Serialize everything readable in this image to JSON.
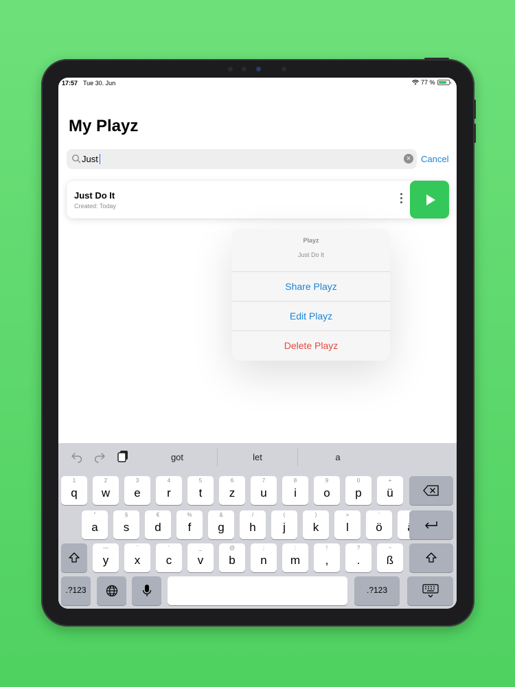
{
  "status": {
    "time": "17:57",
    "date": "Tue 30. Jun",
    "battery": "77 %",
    "battery_level": 0.77
  },
  "page": {
    "title": "My Playz"
  },
  "search": {
    "value": "Just",
    "cancel_label": "Cancel"
  },
  "card": {
    "title": "Just Do It",
    "subtitle": "Created: Today"
  },
  "menu": {
    "title": "Playz",
    "subtitle": "Just Do It",
    "items": [
      {
        "label": "Share Playz",
        "color": "#1a84d6"
      },
      {
        "label": "Edit Playz",
        "color": "#1a84d6"
      },
      {
        "label": "Delete Playz",
        "color": "#e5483e"
      }
    ]
  },
  "keyboard": {
    "suggestions": [
      "got",
      "let",
      "a"
    ],
    "row1": [
      {
        "hint": "1",
        "key": "q"
      },
      {
        "hint": "2",
        "key": "w"
      },
      {
        "hint": "3",
        "key": "e"
      },
      {
        "hint": "4",
        "key": "r"
      },
      {
        "hint": "5",
        "key": "t"
      },
      {
        "hint": "6",
        "key": "z"
      },
      {
        "hint": "7",
        "key": "u"
      },
      {
        "hint": "8",
        "key": "i"
      },
      {
        "hint": "9",
        "key": "o"
      },
      {
        "hint": "0",
        "key": "p"
      },
      {
        "hint": "+",
        "key": "ü"
      }
    ],
    "row2": [
      {
        "hint": "\"",
        "key": "a"
      },
      {
        "hint": "§",
        "key": "s"
      },
      {
        "hint": "€",
        "key": "d"
      },
      {
        "hint": "%",
        "key": "f"
      },
      {
        "hint": "&",
        "key": "g"
      },
      {
        "hint": "/",
        "key": "h"
      },
      {
        "hint": "(",
        "key": "j"
      },
      {
        "hint": ")",
        "key": "k"
      },
      {
        "hint": "=",
        "key": "l"
      },
      {
        "hint": "'",
        "key": "ö"
      },
      {
        "hint": "`",
        "key": "ä"
      }
    ],
    "row3": [
      {
        "hint": "—",
        "key": "y"
      },
      {
        "hint": "`",
        "key": "x"
      },
      {
        "hint": "'",
        "key": "c"
      },
      {
        "hint": "_",
        "key": "v"
      },
      {
        "hint": "@",
        "key": "b"
      },
      {
        "hint": ";",
        "key": "n"
      },
      {
        "hint": ":",
        "key": "m"
      },
      {
        "hint": "!",
        "key": ","
      },
      {
        "hint": "?",
        "key": "."
      },
      {
        "hint": "~",
        "key": "ß"
      }
    ],
    "numbers_label": ".?123",
    "numbers_label_right": ".?123",
    "icons": [
      "undo-icon",
      "redo-icon",
      "clipboard-icon",
      "delete-icon",
      "return-icon",
      "shift-icon",
      "globe-icon",
      "microphone-icon",
      "keyboard-dismiss-icon"
    ]
  }
}
